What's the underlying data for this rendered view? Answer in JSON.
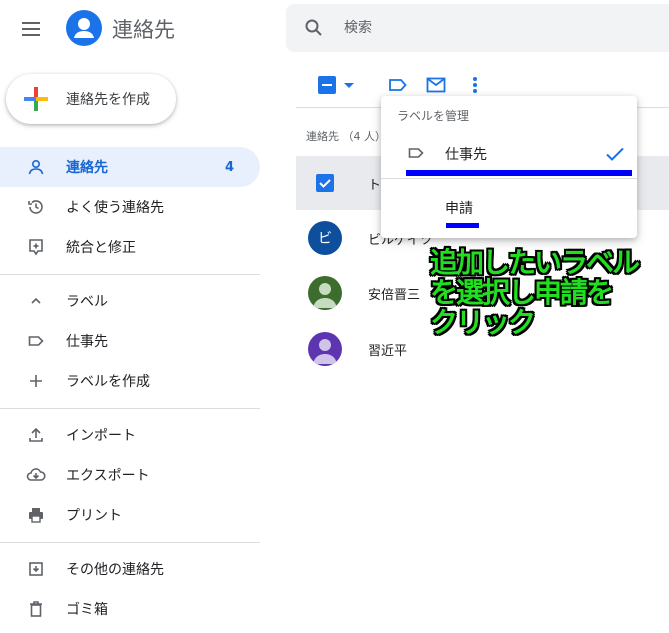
{
  "app": {
    "title": "連絡先"
  },
  "sidebar": {
    "create_label": "連絡先を作成",
    "contacts": {
      "label": "連絡先",
      "count": "4"
    },
    "frequent": "よく使う連絡先",
    "merge": "統合と修正",
    "labels_header": "ラベル",
    "label_items": [
      "仕事先"
    ],
    "create_label_item": "ラベルを作成",
    "import": "インポート",
    "export": "エクスポート",
    "print": "プリント",
    "other_contacts": "その他の連絡先",
    "trash": "ゴミ箱"
  },
  "search": {
    "placeholder": "検索",
    "value": ""
  },
  "list": {
    "header": "連絡先 （4 人）",
    "rows": [
      {
        "name": "ト",
        "selected": true
      },
      {
        "name": "ビルゲイツ",
        "avatar_text": "ビ",
        "avatar_color": "#0d4f9c"
      },
      {
        "name": "安倍晋三",
        "avatar_color": "#3c6d2c"
      },
      {
        "name": "習近平",
        "avatar_color": "#5e35b1"
      }
    ]
  },
  "label_menu": {
    "title": "ラベルを管理",
    "items": [
      {
        "label": "仕事先",
        "checked": true
      },
      {
        "label": "申請",
        "checked": false
      }
    ]
  },
  "annotation": {
    "text": "追加したいラベル\nを選択し申請を\nクリック"
  },
  "colors": {
    "accent": "#1a73e8",
    "highlight": "#0000ff",
    "annotation": "#22dd22"
  }
}
